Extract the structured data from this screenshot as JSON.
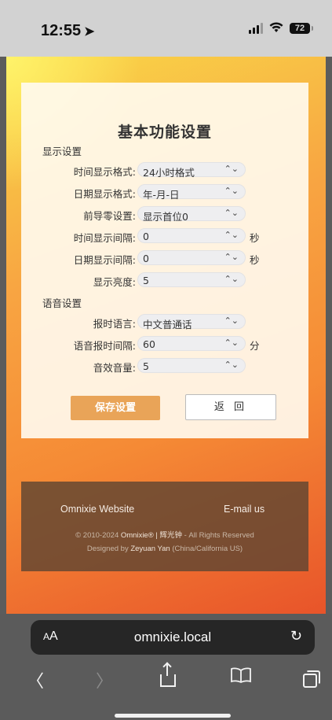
{
  "status": {
    "time": "12:55",
    "battery": "72"
  },
  "panel": {
    "title": "基本功能设置",
    "sections": {
      "display": "显示设置",
      "voice": "语音设置"
    },
    "rows": [
      {
        "label": "时间显示格式:",
        "value": "24小时格式",
        "unit": ""
      },
      {
        "label": "日期显示格式:",
        "value": "年-月-日",
        "unit": ""
      },
      {
        "label": "前导零设置:",
        "value": "显示首位0",
        "unit": ""
      },
      {
        "label": "时间显示间隔:",
        "value": "0",
        "unit": "秒"
      },
      {
        "label": "日期显示间隔:",
        "value": "0",
        "unit": "秒"
      },
      {
        "label": "显示亮度:",
        "value": "5",
        "unit": ""
      },
      {
        "label": "报时语言:",
        "value": "中文普通话",
        "unit": ""
      },
      {
        "label": "语音报时间隔:",
        "value": "60",
        "unit": "分"
      },
      {
        "label": "音效音量:",
        "value": "5",
        "unit": ""
      }
    ],
    "save_label": "保存设置",
    "back_label": "返 回"
  },
  "footer": {
    "website": "Omnixie Website",
    "email": "E-mail us",
    "copyright_prefix": "© 2010-2024",
    "brand": "Omnixie® | 辉光钟",
    "rights": "- All Rights Reserved",
    "designed_prefix": "Designed by",
    "designer": "Zeyuan Yan",
    "designer_location": "(China/California US)"
  },
  "browser": {
    "aa_small": "A",
    "aa_big": "A",
    "url": "omnixie.local"
  }
}
